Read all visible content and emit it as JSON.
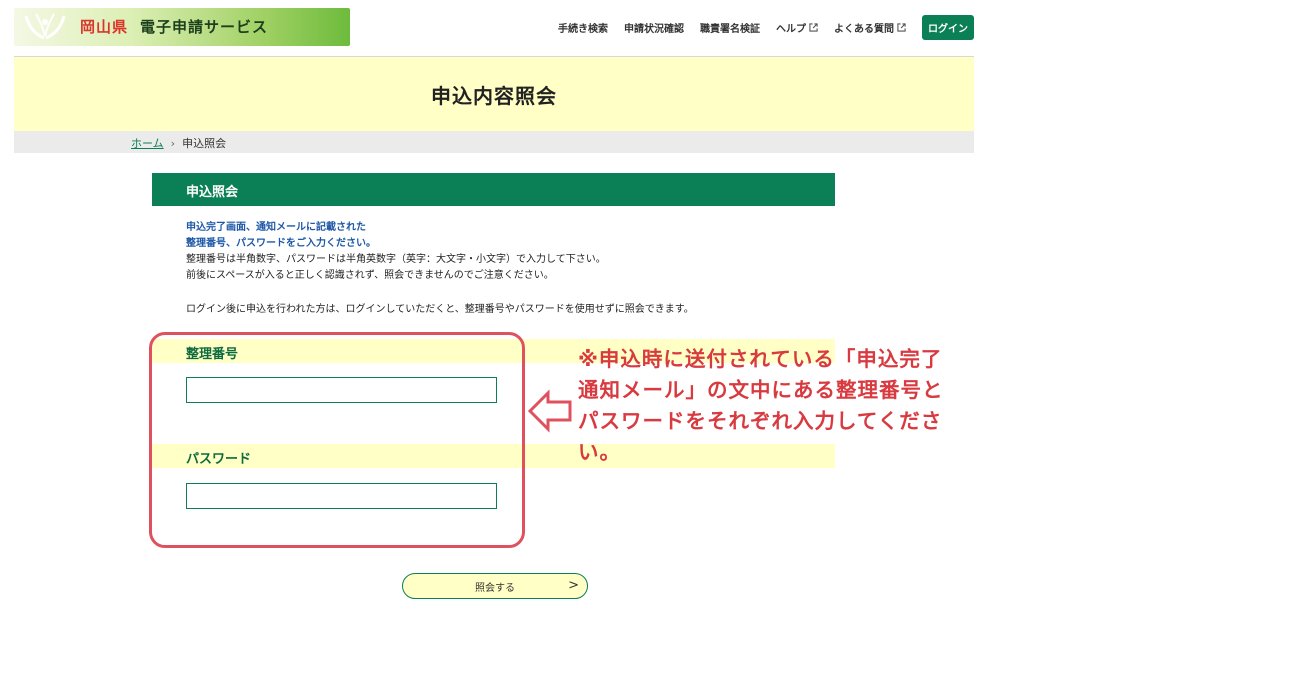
{
  "header": {
    "logo_pref": "岡山県",
    "logo_name": "電子申請サービス",
    "nav": [
      {
        "label": "手続き検索",
        "external": false
      },
      {
        "label": "申請状況確認",
        "external": false
      },
      {
        "label": "職責署名検証",
        "external": false
      },
      {
        "label": "ヘルプ",
        "external": true
      },
      {
        "label": "よくある質問",
        "external": true
      }
    ],
    "login_label": "ログイン"
  },
  "page": {
    "title": "申込内容照会"
  },
  "breadcrumb": {
    "home": "ホーム",
    "separator": "›",
    "current": "申込照会"
  },
  "section": {
    "title": "申込照会",
    "notice_em_1": "申込完了画面、通知メールに記載された",
    "notice_em_2": "整理番号、パスワードをご入力ください。",
    "notice_3": "整理番号は半角数字、パスワードは半角英数字（英字：大文字・小文字）で入力して下さい。",
    "notice_4": "前後にスペースが入ると正しく認識されず、照会できませんのでご注意ください。",
    "notice_5": "ログイン後に申込を行われた方は、ログインしていただくと、整理番号やパスワードを使用せずに照会できます。"
  },
  "form": {
    "number_label": "整理番号",
    "number_value": "",
    "password_label": "パスワード",
    "password_value": "",
    "submit_label": "照会する",
    "submit_chevron": ">"
  },
  "annotation": {
    "text": "※申込時に送付されている「申込完了通知メール」の文中にある整理番号とパスワードをそれぞれ入力してください。",
    "color": "#d83a3f"
  },
  "colors": {
    "brand_green": "#0b7f55",
    "band_yellow": "#ffffc6",
    "highlight_red": "#e0515f"
  }
}
